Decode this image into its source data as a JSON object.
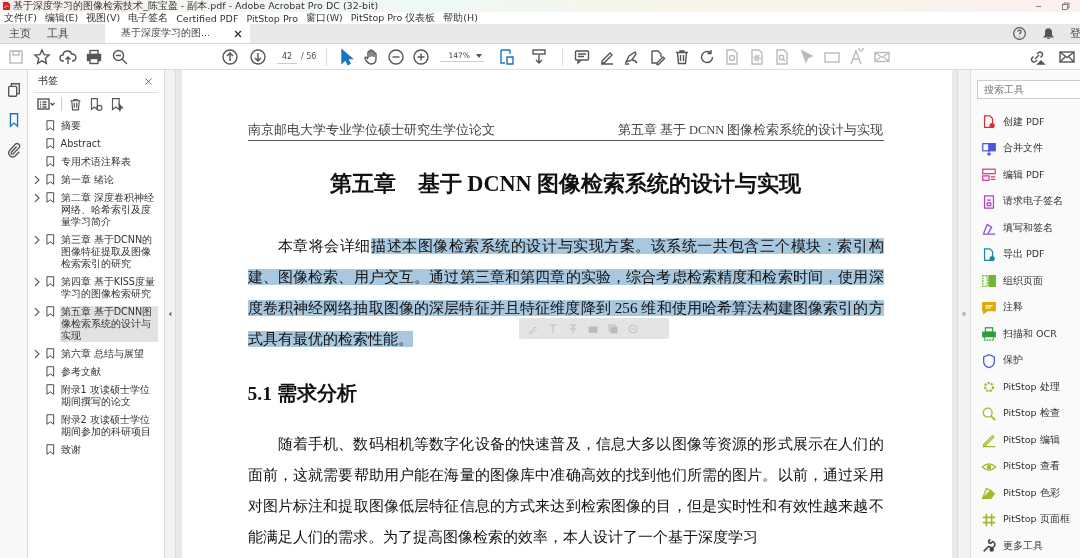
{
  "window": {
    "title": "基于深度学习的图像检索技术_陈宝盈 - 副本.pdf - Adobe Acrobat Pro DC (32-bit)"
  },
  "menu": [
    "文件(F)",
    "编辑(E)",
    "视图(V)",
    "电子签名",
    "Certified PDF",
    "PitStop Pro",
    "窗口(W)",
    "PitStop Pro 仪表板",
    "帮助(H)"
  ],
  "tabs": [
    {
      "label": "主页",
      "selected": false,
      "closable": false
    },
    {
      "label": "工具",
      "selected": false,
      "closable": false
    },
    {
      "label": "基于深度学习的图...",
      "selected": true,
      "closable": true
    }
  ],
  "account": "登",
  "toolbar": {
    "page": "42",
    "page_count": "/ 56",
    "zoom": "147%"
  },
  "navigation_panes": [
    {
      "selected": false
    },
    {
      "selected": true
    },
    {
      "selected": false
    }
  ],
  "bookmarks": {
    "title": "书签",
    "items": [
      {
        "label": "摘要",
        "selected": false
      },
      {
        "label": "Abstract",
        "selected": false
      },
      {
        "label": "专用术语注释表",
        "selected": false
      },
      {
        "label": "第一章 绪论",
        "selected": false,
        "expanded": false
      },
      {
        "label": "第二章 深度卷积神经网络、哈希索引及度量学习简介",
        "selected": false,
        "expanded": false
      },
      {
        "label": "第三章 基于DCNN的图像特征提取及图像检索索引的研究",
        "selected": false,
        "expanded": false
      },
      {
        "label": "第四章 基于KISS度量学习的图像检索研究",
        "selected": false,
        "expanded": false
      },
      {
        "label": "第五章 基于DCNN图像检索系统的设计与实现",
        "selected": true,
        "expanded": false
      },
      {
        "label": "第六章 总结与展望",
        "selected": false,
        "expanded": false
      },
      {
        "label": "参考文献",
        "selected": false
      },
      {
        "label": "附录1 攻读硕士学位期间撰写的论文",
        "selected": false
      },
      {
        "label": "附录2 攻读硕士学位期间参加的科研项目",
        "selected": false
      },
      {
        "label": "致谢",
        "selected": false
      }
    ]
  },
  "document": {
    "header_left": "南京邮电大学专业学位硕士研究生学位论文",
    "header_right": "第五章  基于 DCNN 图像检索系统的设计与实现",
    "chapter_title": "第五章　基于 DCNN 图像检索系统的设计与实现",
    "intro": [
      {
        "text": "本章将会详细",
        "highlighted": false
      },
      {
        "text": "描述本图像检索系统的设计与实现方案。该系统一共包含三个模块：索引构建、图像检索、用户交互。通过第三章和第四章的实验，综合考虑检索精度和检索时间，使用深度卷积神经网络抽取图像的深层特征并且特征维度降到 256 维和使用哈希算法构建图像索引的方式具有最优的检索性能。",
        "highlighted": true
      }
    ],
    "section_heading": "5.1 需求分析",
    "body": "随着手机、数码相机等数字化设备的快速普及，信息大多以图像等资源的形式展示在人们的面前，这就需要帮助用户能在海量的图像库中准确高效的找到他们所需的图片。以前，通过采用对图片标注和提取图像低层特征信息的方式来达到检索图像的目，但是实时性和有效性越来越不能满足人们的需求。为了提高图像检索的效率，本人设计了一个基于深度学习"
  },
  "tools": {
    "search_placeholder": "搜索工具",
    "items": [
      "创建 PDF",
      "合并文件",
      "编辑 PDF",
      "请求电子签名",
      "填写和签名",
      "导出 PDF",
      "组织页面",
      "注释",
      "扫描和 OCR",
      "保护",
      "PitStop 处理",
      "PitStop 检查",
      "PitStop 编辑",
      "PitStop 查看",
      "PitStop 色彩",
      "PitStop 页面框",
      "更多工具"
    ]
  }
}
